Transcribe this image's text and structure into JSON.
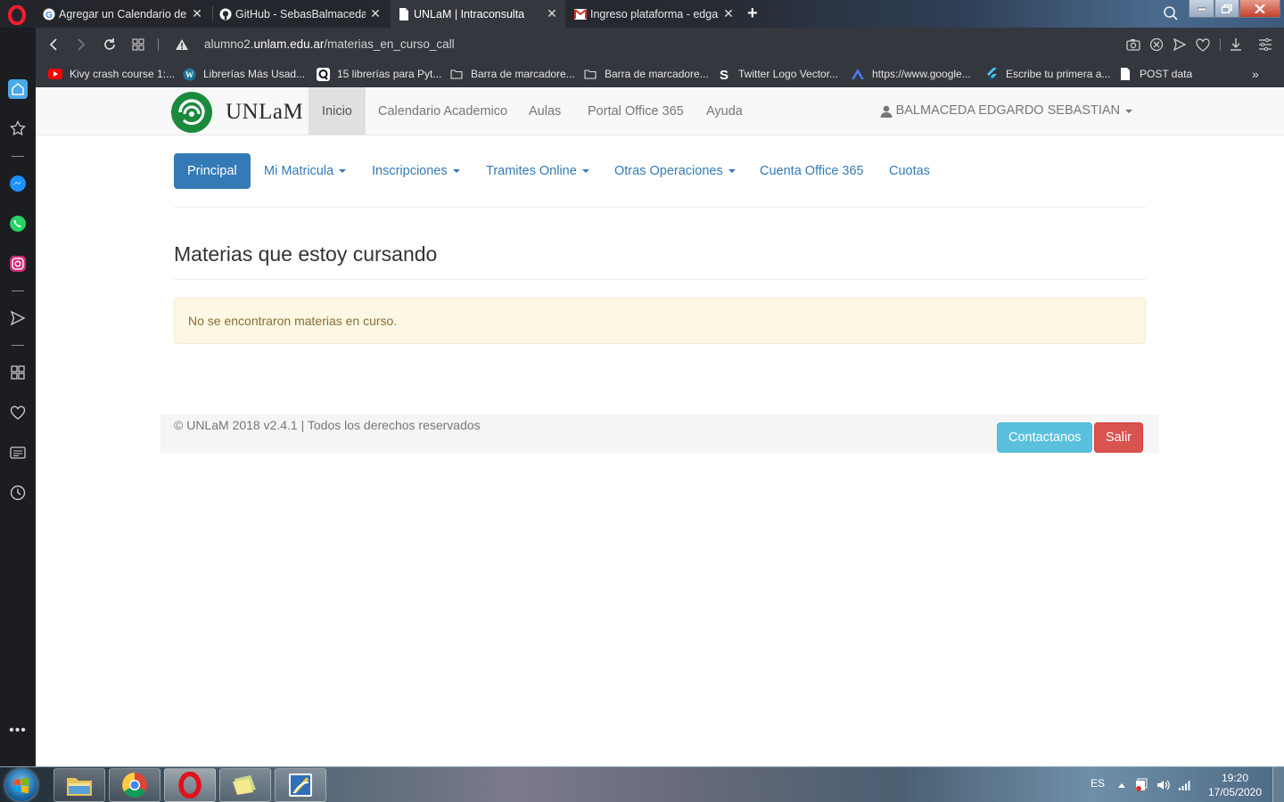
{
  "browser": {
    "tabs": [
      {
        "title": "Agregar un Calendario de G",
        "icon": "google-icon"
      },
      {
        "title": "GitHub - SebasBalmaceda/",
        "icon": "github-icon"
      },
      {
        "title": "UNLaM | Intraconsulta",
        "icon": "page-icon"
      },
      {
        "title": "Ingreso plataforma - edgar",
        "icon": "gmail-icon"
      }
    ],
    "url": {
      "host": "alumno2.unlam.edu.ar",
      "domain": "unlam.edu.ar",
      "prefix": "alumno2.",
      "path": "/materias_en_curso_call"
    },
    "bookmarks": [
      {
        "label": "Kivy crash course 1:...",
        "icon": "youtube-icon"
      },
      {
        "label": "Librerías Más Usad...",
        "icon": "wordpress-icon"
      },
      {
        "label": "15 librerías para Pyt...",
        "icon": "quote-icon"
      },
      {
        "label": "Barra de marcadore...",
        "icon": "folder-icon"
      },
      {
        "label": "Barra de marcadore...",
        "icon": "folder-icon"
      },
      {
        "label": "Twitter Logo Vector...",
        "icon": "s-icon"
      },
      {
        "label": "https://www.google...",
        "icon": "arrow-icon"
      },
      {
        "label": "Escribe tu primera a...",
        "icon": "flutter-icon"
      },
      {
        "label": "POST data",
        "icon": "file-icon"
      }
    ]
  },
  "site": {
    "brand": "UNLaM",
    "topnav": [
      "Inicio",
      "Calendario Academico",
      "Aulas",
      "Portal Office 365",
      "Ayuda"
    ],
    "user": "BALMACEDA EDGARDO SEBASTIAN",
    "pills": [
      "Principal",
      "Mi Matricula",
      "Inscripciones",
      "Tramites Online",
      "Otras Operaciones",
      "Cuenta Office 365",
      "Cuotas"
    ],
    "title": "Materias que estoy cursando",
    "alert": "No se encontraron materias en curso.",
    "footer": "© UNLaM 2018 v2.4.1 | Todos los derechos reservados",
    "contact_btn": "Contactanos",
    "exit_btn": "Salir"
  },
  "taskbar": {
    "lang": "ES",
    "time": "19:20",
    "date": "17/05/2020"
  }
}
